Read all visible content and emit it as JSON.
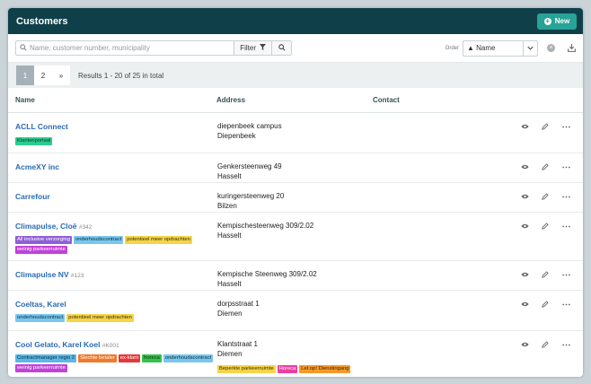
{
  "header": {
    "title": "Customers",
    "new_label": "New"
  },
  "search": {
    "placeholder": "Name, customer number, municipality",
    "filter_label": "Filter"
  },
  "order": {
    "label": "Order",
    "value": "▲ Name"
  },
  "pager": {
    "pages": [
      "1",
      "2",
      "»"
    ],
    "active": "1",
    "results": "Results 1 - 20 of 25 in total"
  },
  "table": {
    "columns": [
      "Name",
      "Address",
      "Contact"
    ]
  },
  "colors": {
    "brand": "#0f4049",
    "accent": "#27a397",
    "link": "#2a6bb5"
  },
  "rows": [
    {
      "name": "ACLL Connect",
      "number": "",
      "address1": "diepenbeek campus",
      "address2": "Diepenbeek",
      "tags": [
        {
          "label": "Klantenportaal",
          "bg": "#2ecc8f",
          "fg": "#0c3322"
        }
      ],
      "addr_tags": []
    },
    {
      "name": "AcmeXY inc",
      "number": "",
      "address1": "Genkersteenweg 49",
      "address2": "Hasselt",
      "tags": [],
      "addr_tags": []
    },
    {
      "name": "Carrefour",
      "number": "",
      "address1": "kuringersteenweg 20",
      "address2": "Bilzen",
      "tags": [],
      "addr_tags": []
    },
    {
      "name": "Climapulse, Cloë",
      "number": "#342",
      "address1": "Kempischesteenweg 309/2.02",
      "address2": "Hasselt",
      "tags": [
        {
          "label": "All inclusive verzorging",
          "bg": "#8e5fd6",
          "fg": "#ffffff"
        },
        {
          "label": "onderhoudscontract",
          "bg": "#79c7ee",
          "fg": "#0c2a3a"
        },
        {
          "label": "potentieel meer opdrachten",
          "bg": "#f5d44a",
          "fg": "#3a2e00"
        },
        {
          "label": "weinig parkeerruimte",
          "bg": "#c043d8",
          "fg": "#ffffff"
        }
      ],
      "addr_tags": []
    },
    {
      "name": "Climapulse NV",
      "number": "#123",
      "address1": "Kempische Steenweg 309/2.02",
      "address2": "Hasselt",
      "tags": [],
      "addr_tags": []
    },
    {
      "name": "Coeltas, Karel",
      "number": "",
      "address1": "dorpsstraat 1",
      "address2": "Diemen",
      "tags": [
        {
          "label": "onderhoudscontract",
          "bg": "#79c7ee",
          "fg": "#0c2a3a"
        },
        {
          "label": "potentieel meer opdrachten",
          "bg": "#f5d44a",
          "fg": "#3a2e00"
        }
      ],
      "addr_tags": []
    },
    {
      "name": "Cool Gelato, Karel Koel",
      "number": "#K001",
      "address1": "Klantstraat 1",
      "address2": "Diemen",
      "tags": [
        {
          "label": "Contractmanager regio 2",
          "bg": "#5bb8e8",
          "fg": "#0c2a3a"
        },
        {
          "label": "Slechte betaler",
          "bg": "#ef7a2c",
          "fg": "#ffffff"
        },
        {
          "label": "ex-klant",
          "bg": "#e03a3a",
          "fg": "#ffffff"
        },
        {
          "label": "horeca",
          "bg": "#35c24a",
          "fg": "#0c2a10"
        },
        {
          "label": "onderhoudscontract",
          "bg": "#79c7ee",
          "fg": "#0c2a3a"
        },
        {
          "label": "weinig parkeerruimte",
          "bg": "#c043d8",
          "fg": "#ffffff"
        }
      ],
      "addr_tags": [
        {
          "label": "Beperkte parkeerruimte",
          "bg": "#f5d44a",
          "fg": "#3a2e00"
        },
        {
          "label": "Horeca",
          "bg": "#ee3ea0",
          "fg": "#ffffff"
        },
        {
          "label": "Let op! Dienstingang",
          "bg": "#f59a2a",
          "fg": "#3a1e00"
        }
      ]
    }
  ]
}
